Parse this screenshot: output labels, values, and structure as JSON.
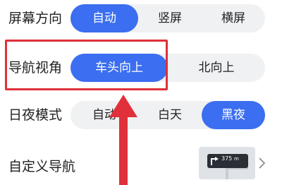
{
  "rows": {
    "screen_orientation": {
      "label": "屏幕方向",
      "options": [
        "自动",
        "竖屏",
        "横屏"
      ],
      "selected": "自动"
    },
    "nav_view": {
      "label": "导航视角",
      "options": [
        "车头向上",
        "北向上"
      ],
      "selected": "车头向上"
    },
    "day_night": {
      "label": "日夜模式",
      "options": [
        "自动",
        "白天",
        "黑夜"
      ],
      "selected": "黑夜"
    },
    "custom_nav": {
      "label": "自定义导航",
      "preview_distance": "375",
      "preview_unit": "m"
    }
  },
  "colors": {
    "accent": "#3b6ef0",
    "segment_bg": "#f0f1f3",
    "highlight": "#e0303a"
  },
  "icons": [
    "turn-left-icon",
    "chevron-right-icon",
    "red-arrow-annotation"
  ]
}
